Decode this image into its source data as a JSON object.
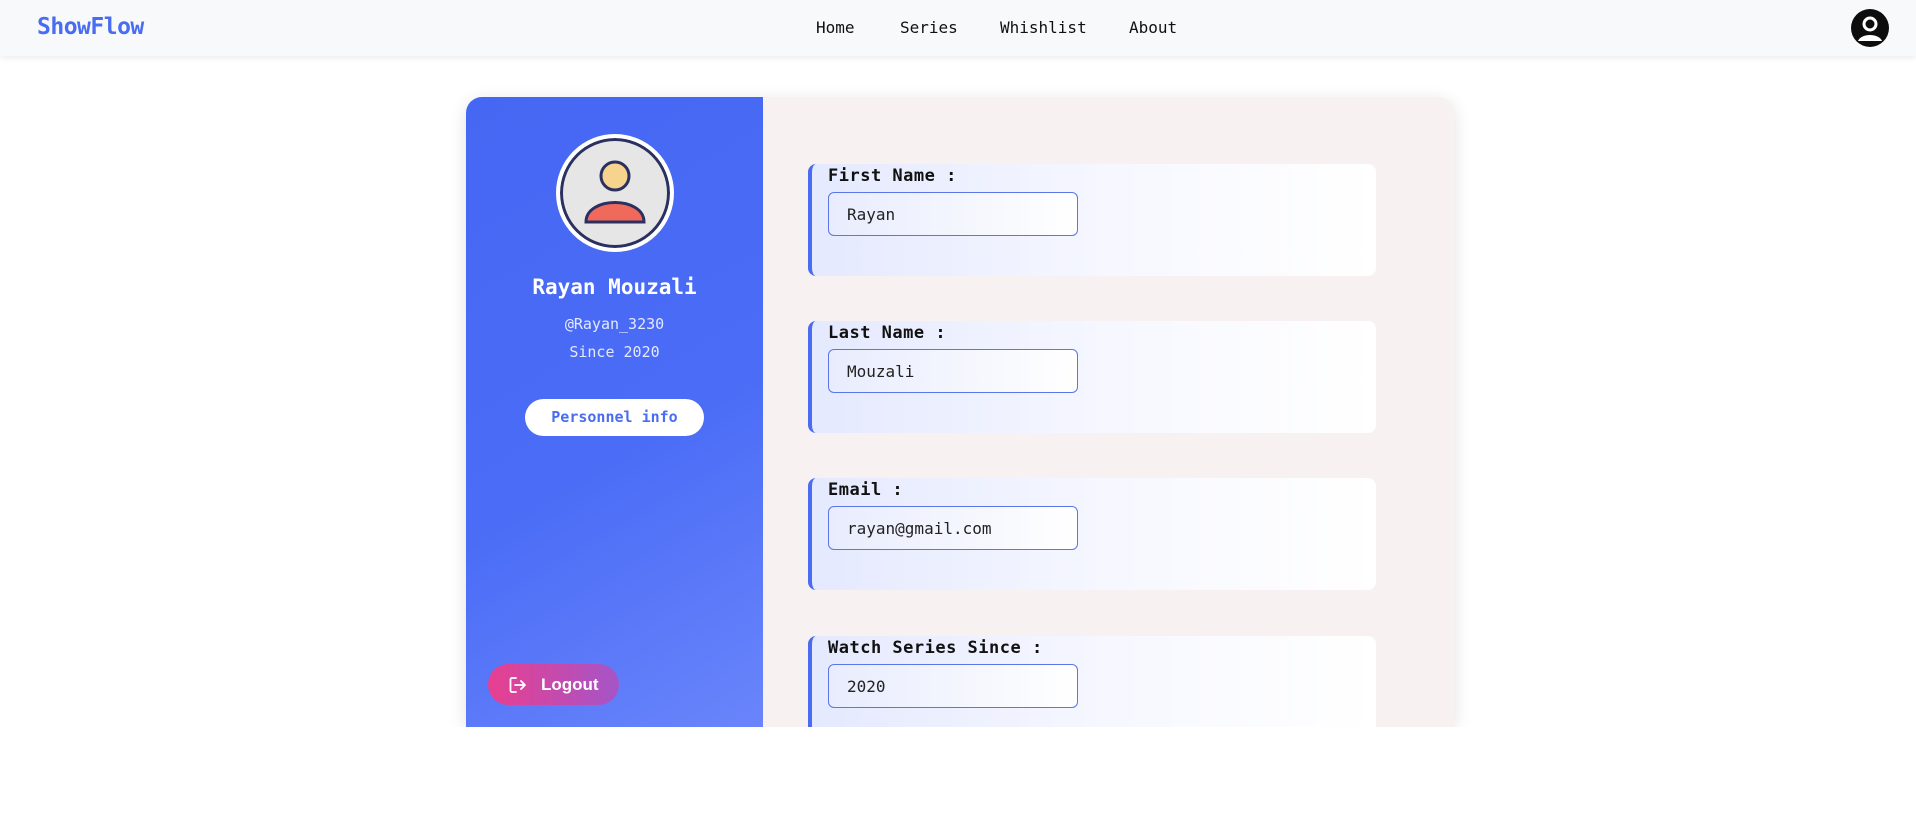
{
  "header": {
    "brand": "ShowFlow",
    "nav": [
      {
        "label": "Home"
      },
      {
        "label": "Series"
      },
      {
        "label": "Whishlist"
      },
      {
        "label": "About"
      }
    ]
  },
  "profile": {
    "name": "Rayan Mouzali",
    "handle": "@Rayan_3230",
    "since": "Since 2020",
    "info_button": "Personnel info",
    "logout_button": "Logout"
  },
  "form": {
    "fields": [
      {
        "label": "First Name :",
        "value": "Rayan"
      },
      {
        "label": "Last Name :",
        "value": "Mouzali"
      },
      {
        "label": "Email :",
        "value": "rayan@gmail.com"
      },
      {
        "label": "Watch Series Since :",
        "value": "2020"
      }
    ]
  },
  "colors": {
    "accent": "#4a6cf0",
    "logout_gradient_start": "#e83f8f",
    "logout_gradient_end": "#a555c8"
  }
}
